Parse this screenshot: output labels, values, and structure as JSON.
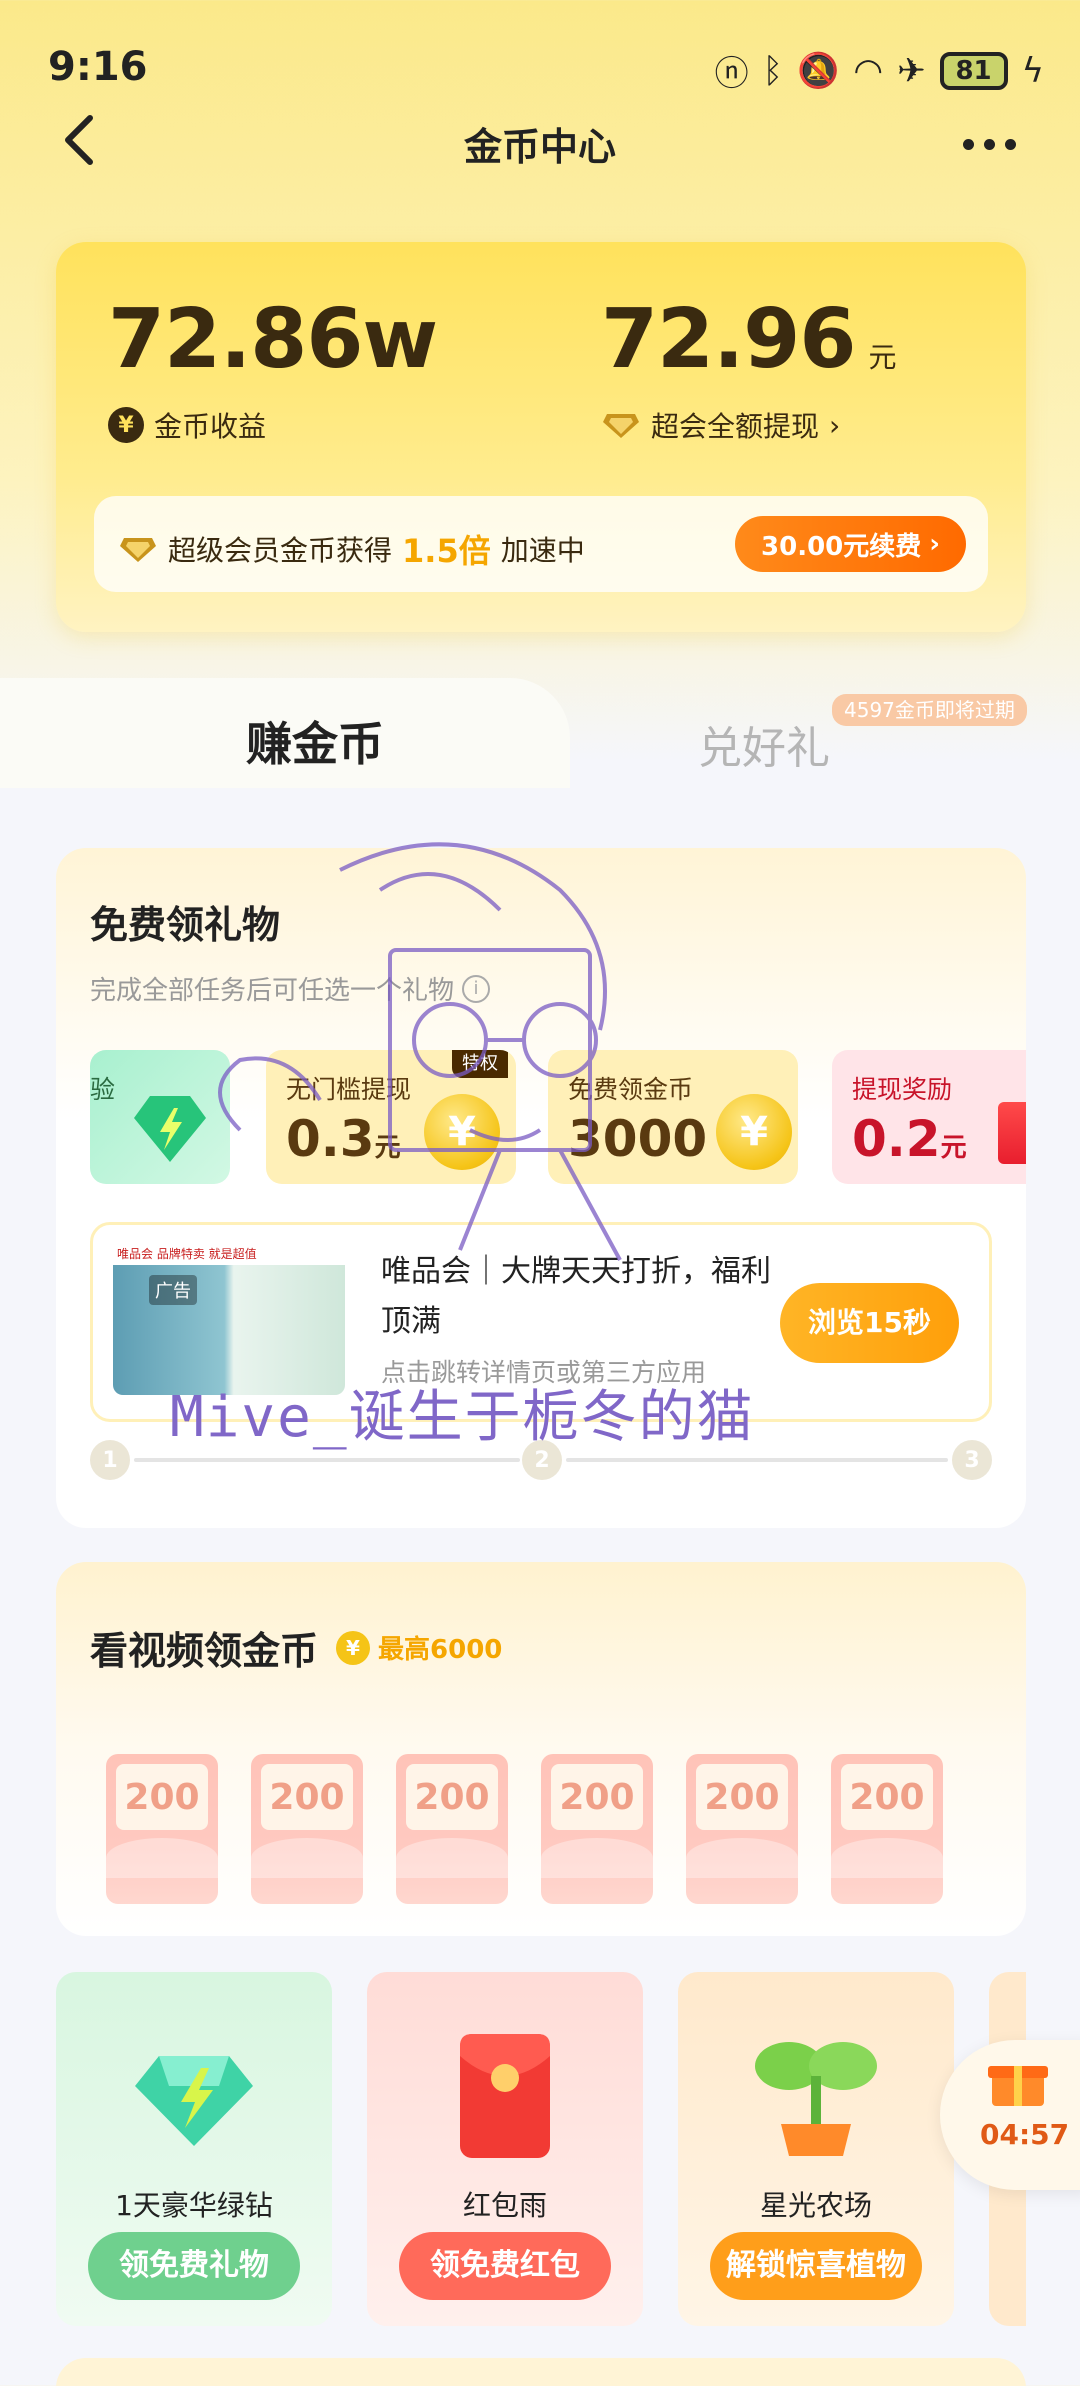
{
  "status_bar": {
    "time": "9:16",
    "battery": "81",
    "icons": [
      "nfc-icon",
      "bluetooth-icon",
      "mute-icon",
      "wifi-icon",
      "airplane-icon",
      "battery-icon",
      "charging-icon"
    ]
  },
  "nav": {
    "title": "金币中心"
  },
  "summary": {
    "coin_income_value": "72.86w",
    "coin_income_label": "金币收益",
    "cash_value": "72.96",
    "cash_unit": "元",
    "cash_label": "超会全额提现",
    "vip_text_prefix": "超级会员金币获得",
    "vip_multiplier": "1.5倍",
    "vip_text_suffix": "加速中",
    "renew_button": "30.00元续费"
  },
  "tabs": {
    "earn": "赚金币",
    "redeem": "兑好礼",
    "expire_badge": "4597金币即将过期"
  },
  "gift_section": {
    "title": "免费领礼物",
    "subtitle": "完成全部任务后可任选一个礼物",
    "tiles": [
      {
        "label": "验",
        "value": "",
        "unit": ""
      },
      {
        "label": "无门槛提现",
        "value": "0.3",
        "unit": "元",
        "badge": "特权"
      },
      {
        "label": "免费领金币",
        "value": "3000",
        "unit": ""
      },
      {
        "label": "提现奖励",
        "value": "0.2",
        "unit": "元"
      }
    ],
    "ad": {
      "tag": "广告",
      "thumb_text": "唯品会 品牌特卖 就是超值",
      "title": "唯品会｜大牌天天打折，福利顶满",
      "desc": "点击跳转详情页或第三方应用",
      "button": "浏览15秒"
    },
    "progress_steps": [
      "1",
      "2",
      "3"
    ]
  },
  "video_section": {
    "title": "看视频领金币",
    "max_label": "最高6000",
    "rewards": [
      "200",
      "200",
      "200",
      "200",
      "200",
      "200"
    ]
  },
  "features": [
    {
      "name": "1天豪华绿钻",
      "button": "领免费礼物"
    },
    {
      "name": "红包雨",
      "button": "领免费红包"
    },
    {
      "name": "星光农场",
      "button": "解锁惊喜植物"
    }
  ],
  "timer": {
    "countdown": "04:57"
  },
  "watermark": "Mive_诞生于栀冬的猫",
  "colors": {
    "accent_orange": "#ff6a00",
    "gold": "#f5c417",
    "brown_text": "#3a2a10",
    "green_button": "#6fd08e",
    "red_button": "#ff6a5a",
    "orange_button": "#ff9e1a"
  }
}
